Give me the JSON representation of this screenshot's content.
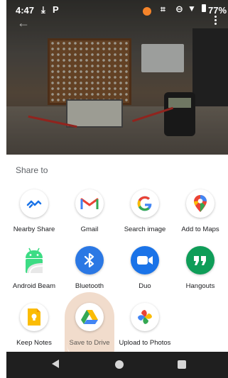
{
  "status_bar": {
    "time": "4:47",
    "battery_percent": "77%",
    "icons": [
      "download-icon",
      "parking-icon",
      "notification-dot-icon",
      "scan-icon",
      "dnd-icon",
      "wifi-icon",
      "battery-icon"
    ]
  },
  "share_sheet": {
    "title": "Share to",
    "targets": [
      {
        "label": "Nearby Share",
        "icon": "nearby-share-icon"
      },
      {
        "label": "Gmail",
        "icon": "gmail-icon"
      },
      {
        "label": "Search image",
        "icon": "google-icon"
      },
      {
        "label": "Add to Maps",
        "icon": "maps-pin-icon"
      },
      {
        "label": "Android Beam",
        "icon": "android-icon"
      },
      {
        "label": "Bluetooth",
        "icon": "bluetooth-icon"
      },
      {
        "label": "Duo",
        "icon": "duo-icon"
      },
      {
        "label": "Hangouts",
        "icon": "hangouts-icon"
      },
      {
        "label": "Keep Notes",
        "icon": "keep-icon"
      },
      {
        "label": "Save to Drive",
        "icon": "drive-icon"
      },
      {
        "label": "Upload to Photos",
        "icon": "photos-icon"
      }
    ]
  },
  "colors": {
    "bluetooth": "#2b78e4",
    "duo": "#1a73e8",
    "hangouts": "#0f9d58",
    "pressed_highlight": "#f1dccc",
    "nav_bar": "#1f1f1f"
  }
}
